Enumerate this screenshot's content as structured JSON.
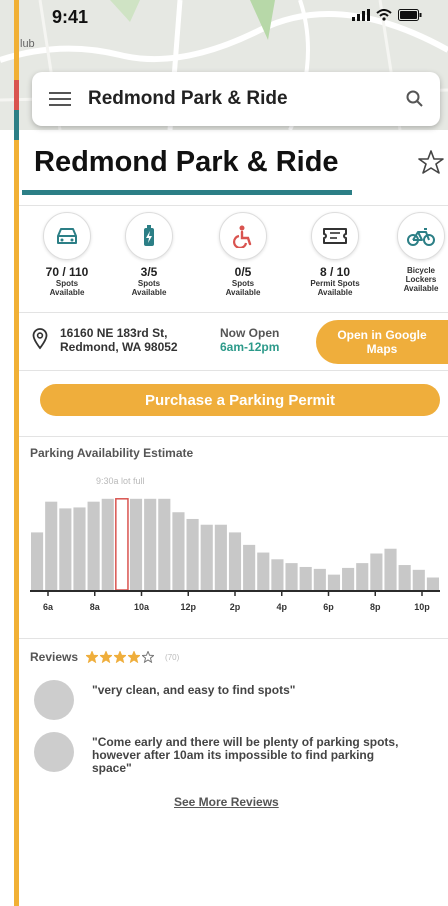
{
  "status_bar": {
    "time": "9:41"
  },
  "map": {
    "label": "lub"
  },
  "search": {
    "text": "Redmond Park & Ride"
  },
  "page": {
    "title": "Redmond Park & Ride"
  },
  "features": [
    {
      "icon": "car-icon",
      "count": "70 / 110",
      "label": "Spots\nAvailable"
    },
    {
      "icon": "ev-charging-icon",
      "count": "3/5",
      "label": "Spots\nAvailable"
    },
    {
      "icon": "wheelchair-icon",
      "count": "0/5",
      "label": "Spots\nAvailable"
    },
    {
      "icon": "permit-ticket-icon",
      "count": "8 / 10",
      "label": "Permit Spots\nAvailable"
    },
    {
      "icon": "bicycle-icon",
      "count": "",
      "label": "Bicycle\nLockers\nAvailable"
    }
  ],
  "info": {
    "address": "16160 NE 183rd St,\nRedmond, WA 98052",
    "open_now": "Now Open",
    "hours": "6am-12pm",
    "maps_button": "Open in Google Maps"
  },
  "permit_button": "Purchase a Parking Permit",
  "chart_data": {
    "type": "bar",
    "title": "Parking Availability Estimate",
    "annotation": "9:30a lot full",
    "highlight_index": 6,
    "x_tick_labels": [
      "6a",
      "8a",
      "10a",
      "12p",
      "2p",
      "4p",
      "6p",
      "8p",
      "10p"
    ],
    "values": [
      60,
      92,
      85,
      86,
      92,
      95,
      95,
      95,
      95,
      95,
      81,
      74,
      68,
      68,
      60,
      47,
      39,
      32,
      28,
      24,
      22,
      16,
      23,
      28,
      38,
      43,
      26,
      21,
      13
    ],
    "ylim": [
      0,
      100
    ],
    "grid": false,
    "colors": {
      "bar": "#c8c8c8",
      "highlight": "#d9534f",
      "axis": "#2b2b2b"
    }
  },
  "reviews": {
    "title": "Reviews",
    "rating": 4,
    "max_rating": 5,
    "count": "(70)",
    "items": [
      {
        "text": "\"very clean, and easy to find spots\""
      },
      {
        "text": "\"Come early and there will be plenty of parking spots, however after 10am its impossible to find parking space\""
      }
    ],
    "see_more": "See More Reviews"
  },
  "colors": {
    "accent": "#efae3c",
    "teal": "#2c7f86",
    "red": "#d9534f"
  }
}
